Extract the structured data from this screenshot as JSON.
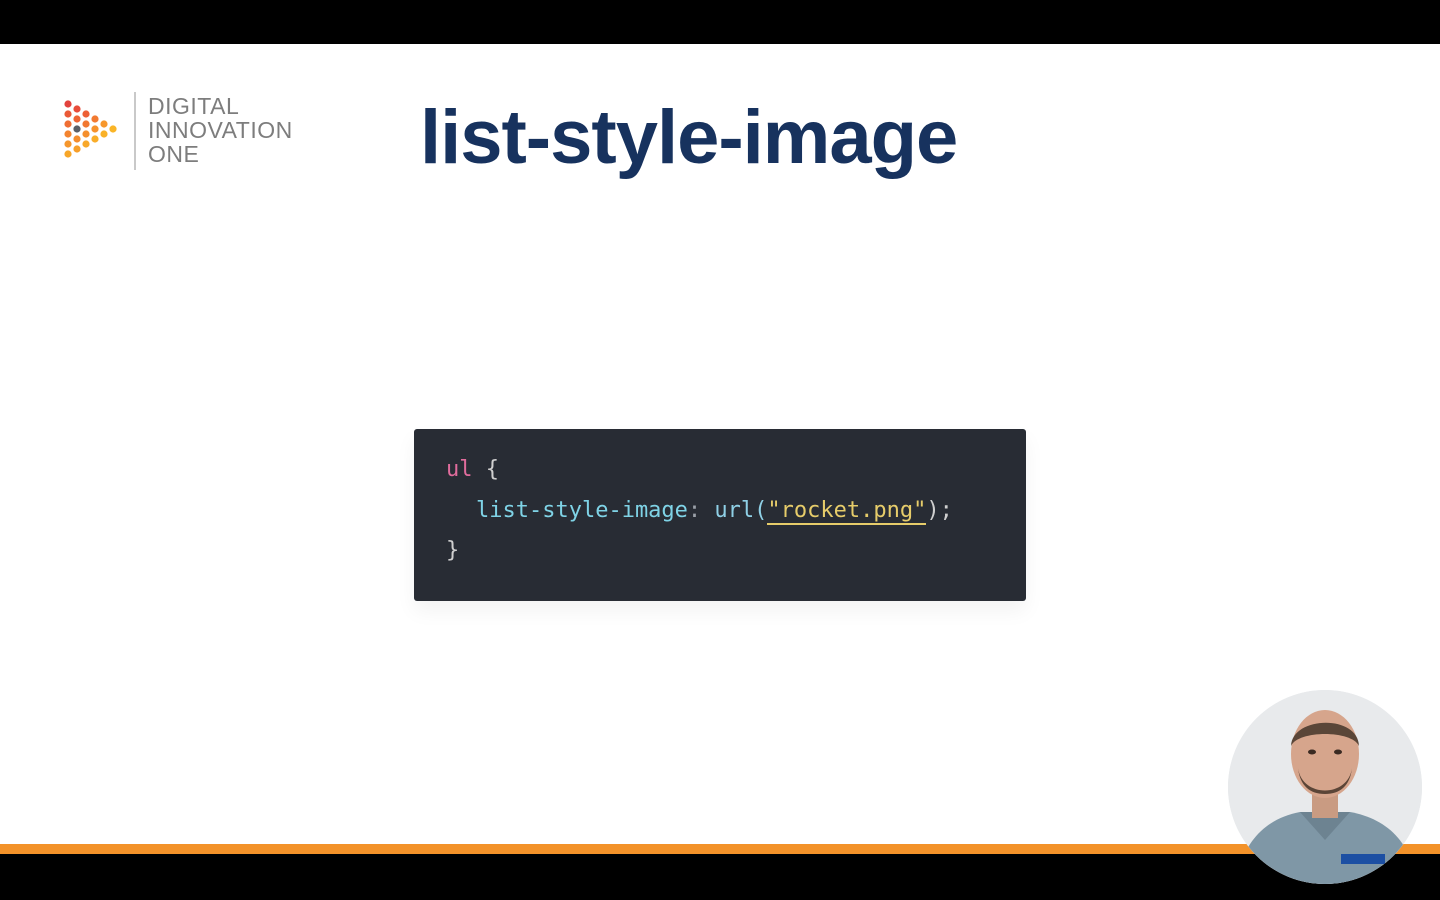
{
  "logo": {
    "lines": [
      "DIGITAL",
      "INNOVATION",
      "ONE"
    ],
    "icon": "hexagon-play-dot-grid-icon"
  },
  "slide": {
    "title": "list-style-image"
  },
  "code": {
    "language": "css",
    "selector": "ul",
    "open_brace": "{",
    "property": "list-style-image",
    "colon": ":",
    "function_open": "url(",
    "string": "\"rocket.png\"",
    "function_close": ");",
    "close_brace": "}"
  },
  "presenter": {
    "avatar": "presenter-webcam"
  },
  "colors": {
    "accent_bar": "#f39229",
    "title": "#17325e",
    "code_background": "#282c34",
    "logo_text": "#7d7d7d"
  }
}
